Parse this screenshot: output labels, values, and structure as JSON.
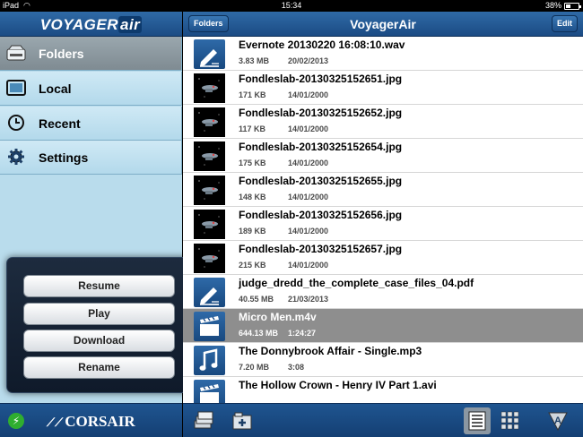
{
  "status_bar": {
    "device": "iPad",
    "time": "15:34",
    "battery_text": "38%",
    "battery_level": 0.38
  },
  "sidebar": {
    "logo": {
      "text_a": "VOYAGER",
      "text_b": "air"
    },
    "items": [
      {
        "label": "Folders",
        "icon": "drive-icon",
        "active": true
      },
      {
        "label": "Local",
        "icon": "ipad-icon",
        "active": false
      },
      {
        "label": "Recent",
        "icon": "clock-icon",
        "active": false
      },
      {
        "label": "Settings",
        "icon": "gear-icon",
        "active": false
      }
    ],
    "bottom": {
      "brand": "CORSAIR",
      "power_icon": "power-icon"
    }
  },
  "popup_menu": {
    "items": [
      {
        "label": "Resume"
      },
      {
        "label": "Play"
      },
      {
        "label": "Download"
      },
      {
        "label": "Rename"
      }
    ]
  },
  "header": {
    "title": "VoyagerAir",
    "left_button": "Folders",
    "right_button": "Edit"
  },
  "files": [
    {
      "name": "Evernote 20130220 16:08:10.wav",
      "size": "3.83 MB",
      "date": "20/02/2013",
      "thumb": "doc"
    },
    {
      "name": "Fondleslab-20130325152651.jpg",
      "size": "171 KB",
      "date": "14/01/2000",
      "thumb": "photo"
    },
    {
      "name": "Fondleslab-20130325152652.jpg",
      "size": "117 KB",
      "date": "14/01/2000",
      "thumb": "photo"
    },
    {
      "name": "Fondleslab-20130325152654.jpg",
      "size": "175 KB",
      "date": "14/01/2000",
      "thumb": "photo"
    },
    {
      "name": "Fondleslab-20130325152655.jpg",
      "size": "148 KB",
      "date": "14/01/2000",
      "thumb": "photo"
    },
    {
      "name": "Fondleslab-20130325152656.jpg",
      "size": "189 KB",
      "date": "14/01/2000",
      "thumb": "photo"
    },
    {
      "name": "Fondleslab-20130325152657.jpg",
      "size": "215 KB",
      "date": "14/01/2000",
      "thumb": "photo"
    },
    {
      "name": "judge_dredd_the_complete_case_files_04.pdf",
      "size": "40.55 MB",
      "date": "21/03/2013",
      "thumb": "doc"
    },
    {
      "name": "Micro Men.m4v",
      "size": "644.13 MB",
      "date": "1:24:27",
      "thumb": "video",
      "selected": true
    },
    {
      "name": "The Donnybrook Affair - Single.mp3",
      "size": "7.20 MB",
      "date": "3:08",
      "thumb": "audio"
    },
    {
      "name": "The Hollow Crown - Henry IV Part 1.avi",
      "size": "",
      "date": "",
      "thumb": "video"
    }
  ],
  "toolbar": {
    "icons": [
      "stack-icon",
      "add-folder-icon",
      "list-view-icon",
      "grid-view-icon",
      "sort-icon"
    ]
  },
  "colors": {
    "bar_blue": "#1b4b84",
    "sidebar_bg": "#b9dcec",
    "selected_row": "#8e8e8e"
  }
}
